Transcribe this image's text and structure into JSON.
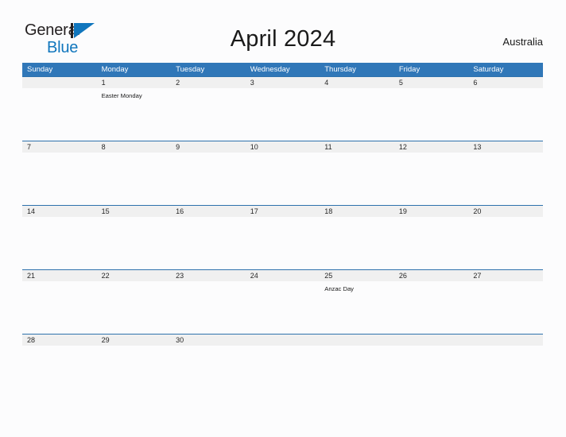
{
  "logo": {
    "text_top": "General",
    "text_bottom": "Blue",
    "mark_icon": "blue-triangle-logo-icon",
    "color_dark": "#231f20",
    "color_blue": "#1076bd"
  },
  "header": {
    "title": "April 2024",
    "region": "Australia"
  },
  "colors": {
    "header_blue": "#3077b8",
    "row_divider_blue": "#2e72ad",
    "date_band_gray": "#f0f0f0",
    "page_background": "#fcfcfd",
    "text_dark": "#262626"
  },
  "calendar": {
    "month": "April",
    "year": "2024",
    "weekday_headers": [
      "Sunday",
      "Monday",
      "Tuesday",
      "Wednesday",
      "Thursday",
      "Friday",
      "Saturday"
    ],
    "weeks": [
      {
        "days": [
          {
            "date": "",
            "event": ""
          },
          {
            "date": "1",
            "event": "Easter Monday"
          },
          {
            "date": "2",
            "event": ""
          },
          {
            "date": "3",
            "event": ""
          },
          {
            "date": "4",
            "event": ""
          },
          {
            "date": "5",
            "event": ""
          },
          {
            "date": "6",
            "event": ""
          }
        ]
      },
      {
        "days": [
          {
            "date": "7",
            "event": ""
          },
          {
            "date": "8",
            "event": ""
          },
          {
            "date": "9",
            "event": ""
          },
          {
            "date": "10",
            "event": ""
          },
          {
            "date": "11",
            "event": ""
          },
          {
            "date": "12",
            "event": ""
          },
          {
            "date": "13",
            "event": ""
          }
        ]
      },
      {
        "days": [
          {
            "date": "14",
            "event": ""
          },
          {
            "date": "15",
            "event": ""
          },
          {
            "date": "16",
            "event": ""
          },
          {
            "date": "17",
            "event": ""
          },
          {
            "date": "18",
            "event": ""
          },
          {
            "date": "19",
            "event": ""
          },
          {
            "date": "20",
            "event": ""
          }
        ]
      },
      {
        "days": [
          {
            "date": "21",
            "event": ""
          },
          {
            "date": "22",
            "event": ""
          },
          {
            "date": "23",
            "event": ""
          },
          {
            "date": "24",
            "event": ""
          },
          {
            "date": "25",
            "event": "Anzac Day"
          },
          {
            "date": "26",
            "event": ""
          },
          {
            "date": "27",
            "event": ""
          }
        ]
      },
      {
        "days": [
          {
            "date": "28",
            "event": ""
          },
          {
            "date": "29",
            "event": ""
          },
          {
            "date": "30",
            "event": ""
          },
          {
            "date": "",
            "event": ""
          },
          {
            "date": "",
            "event": ""
          },
          {
            "date": "",
            "event": ""
          },
          {
            "date": "",
            "event": ""
          }
        ]
      }
    ]
  }
}
